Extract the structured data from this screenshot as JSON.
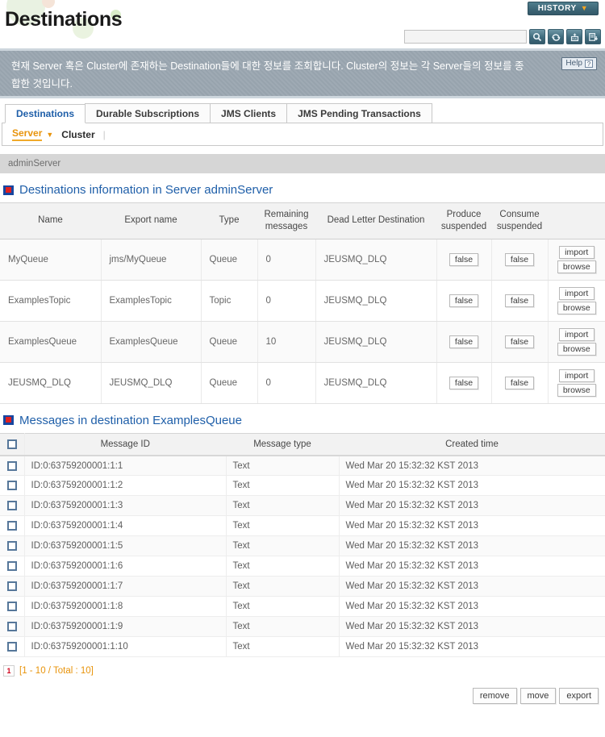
{
  "header": {
    "title": "Destinations",
    "history_label": "HISTORY",
    "history_caret": "▼",
    "search_value": "",
    "search_placeholder": "",
    "tools": [
      {
        "name": "search-icon",
        "label": "search"
      },
      {
        "name": "refresh-icon",
        "label": "refresh"
      },
      {
        "name": "xml-export-icon",
        "label": "xml"
      },
      {
        "name": "report-download-icon",
        "label": "report"
      }
    ]
  },
  "description": {
    "text": "현재 Server 혹은 Cluster에 존재하는 Destination들에 대한 정보를 조회합니다. Cluster의 정보는 각 Server들의 정보를 종합한 것입니다.",
    "help_label": "Help",
    "help_mark": "?"
  },
  "tabs": [
    {
      "label": "Destinations",
      "active": true
    },
    {
      "label": "Durable Subscriptions",
      "active": false
    },
    {
      "label": "JMS Clients",
      "active": false
    },
    {
      "label": "JMS Pending Transactions",
      "active": false
    }
  ],
  "subnav": {
    "items": [
      {
        "label": "Server",
        "current": true
      },
      {
        "label": "Cluster",
        "current": false
      }
    ],
    "caret": "▼",
    "separator": "|"
  },
  "server_bar": {
    "name": "adminServer"
  },
  "destinations_section": {
    "title": "Destinations information in Server adminServer",
    "columns": [
      "Name",
      "Export name",
      "Type",
      "Remaining messages",
      "Dead Letter Destination",
      "Produce suspended",
      "Consume suspended",
      ""
    ],
    "rows": [
      {
        "name": "MyQueue",
        "export_name": "jms/MyQueue",
        "type": "Queue",
        "remaining": "0",
        "dlq": "JEUSMQ_DLQ",
        "produce_suspended": "false",
        "consume_suspended": "false",
        "import_label": "import",
        "browse_label": "browse"
      },
      {
        "name": "ExamplesTopic",
        "export_name": "ExamplesTopic",
        "type": "Topic",
        "remaining": "0",
        "dlq": "JEUSMQ_DLQ",
        "produce_suspended": "false",
        "consume_suspended": "false",
        "import_label": "import",
        "browse_label": "browse"
      },
      {
        "name": "ExamplesQueue",
        "export_name": "ExamplesQueue",
        "type": "Queue",
        "remaining": "10",
        "dlq": "JEUSMQ_DLQ",
        "produce_suspended": "false",
        "consume_suspended": "false",
        "import_label": "import",
        "browse_label": "browse"
      },
      {
        "name": "JEUSMQ_DLQ",
        "export_name": "JEUSMQ_DLQ",
        "type": "Queue",
        "remaining": "0",
        "dlq": "JEUSMQ_DLQ",
        "produce_suspended": "false",
        "consume_suspended": "false",
        "import_label": "import",
        "browse_label": "browse"
      }
    ]
  },
  "messages_section": {
    "title": "Messages in destination ExamplesQueue",
    "columns": [
      "",
      "Message ID",
      "Message type",
      "Created time"
    ],
    "rows": [
      {
        "id": "ID:0:63759200001:1:1",
        "type": "Text",
        "created": "Wed Mar 20 15:32:32 KST 2013"
      },
      {
        "id": "ID:0:63759200001:1:2",
        "type": "Text",
        "created": "Wed Mar 20 15:32:32 KST 2013"
      },
      {
        "id": "ID:0:63759200001:1:3",
        "type": "Text",
        "created": "Wed Mar 20 15:32:32 KST 2013"
      },
      {
        "id": "ID:0:63759200001:1:4",
        "type": "Text",
        "created": "Wed Mar 20 15:32:32 KST 2013"
      },
      {
        "id": "ID:0:63759200001:1:5",
        "type": "Text",
        "created": "Wed Mar 20 15:32:32 KST 2013"
      },
      {
        "id": "ID:0:63759200001:1:6",
        "type": "Text",
        "created": "Wed Mar 20 15:32:32 KST 2013"
      },
      {
        "id": "ID:0:63759200001:1:7",
        "type": "Text",
        "created": "Wed Mar 20 15:32:32 KST 2013"
      },
      {
        "id": "ID:0:63759200001:1:8",
        "type": "Text",
        "created": "Wed Mar 20 15:32:32 KST 2013"
      },
      {
        "id": "ID:0:63759200001:1:9",
        "type": "Text",
        "created": "Wed Mar 20 15:32:32 KST 2013"
      },
      {
        "id": "ID:0:63759200001:1:10",
        "type": "Text",
        "created": "Wed Mar 20 15:32:32 KST 2013"
      }
    ],
    "pager": {
      "page": "1",
      "info": "[1 - 10 / Total : 10]"
    },
    "actions": [
      {
        "label": "remove",
        "name": "remove-button"
      },
      {
        "label": "move",
        "name": "move-button"
      },
      {
        "label": "export",
        "name": "export-button"
      }
    ]
  },
  "colors": {
    "accent_blue": "#1f5fa9",
    "accent_orange": "#e8940c",
    "banner_gray": "#9aa6b0",
    "history_teal": "#3c6575",
    "icon_red": "#e02020"
  }
}
